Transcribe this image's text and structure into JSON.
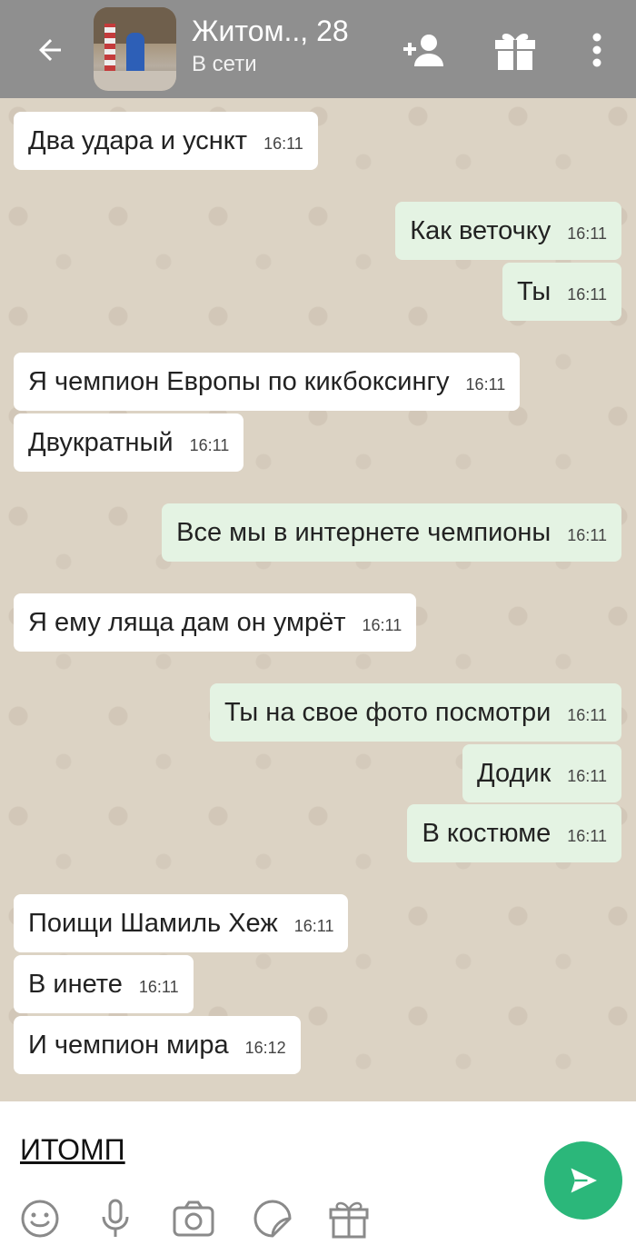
{
  "header": {
    "name": "Житом.., 28",
    "status": "В сети",
    "icons": [
      "back-arrow-icon",
      "add-user-icon",
      "gift-icon",
      "more-vert-icon"
    ]
  },
  "messages": [
    {
      "dir": "in",
      "text": "Два удара и уснкт",
      "time": "16:11"
    },
    {
      "dir": "out",
      "text": "Как веточку",
      "time": "16:11"
    },
    {
      "dir": "out",
      "text": "Ты",
      "time": "16:11"
    },
    {
      "dir": "in",
      "text": "Я чемпион Европы по кикбоксингу",
      "time": "16:11"
    },
    {
      "dir": "in",
      "text": "Двукратный",
      "time": "16:11"
    },
    {
      "dir": "out",
      "text": "Все мы в интернете чемпионы",
      "time": "16:11"
    },
    {
      "dir": "in",
      "text": "Я ему ляща дам он умрёт",
      "time": "16:11"
    },
    {
      "dir": "out",
      "text": "Ты на свое фото посмотри",
      "time": "16:11"
    },
    {
      "dir": "out",
      "text": "Додик",
      "time": "16:11"
    },
    {
      "dir": "out",
      "text": "В костюме",
      "time": "16:11"
    },
    {
      "dir": "in",
      "text": "Поищи Шамиль Хеж",
      "time": "16:11"
    },
    {
      "dir": "in",
      "text": "В инете",
      "time": "16:11"
    },
    {
      "dir": "in",
      "text": "И чемпион мира",
      "time": "16:12"
    }
  ],
  "composer": {
    "input_value": "ИТОМП",
    "tools": [
      "emoji-icon",
      "microphone-icon",
      "camera-icon",
      "sticker-icon",
      "gift-icon"
    ]
  },
  "colors": {
    "header_bg": "#8f8f8f",
    "incoming_bubble": "#ffffff",
    "outgoing_bubble": "#e4f3e3",
    "send_button": "#2bb77a",
    "chat_bg": "#dcd3c4"
  }
}
